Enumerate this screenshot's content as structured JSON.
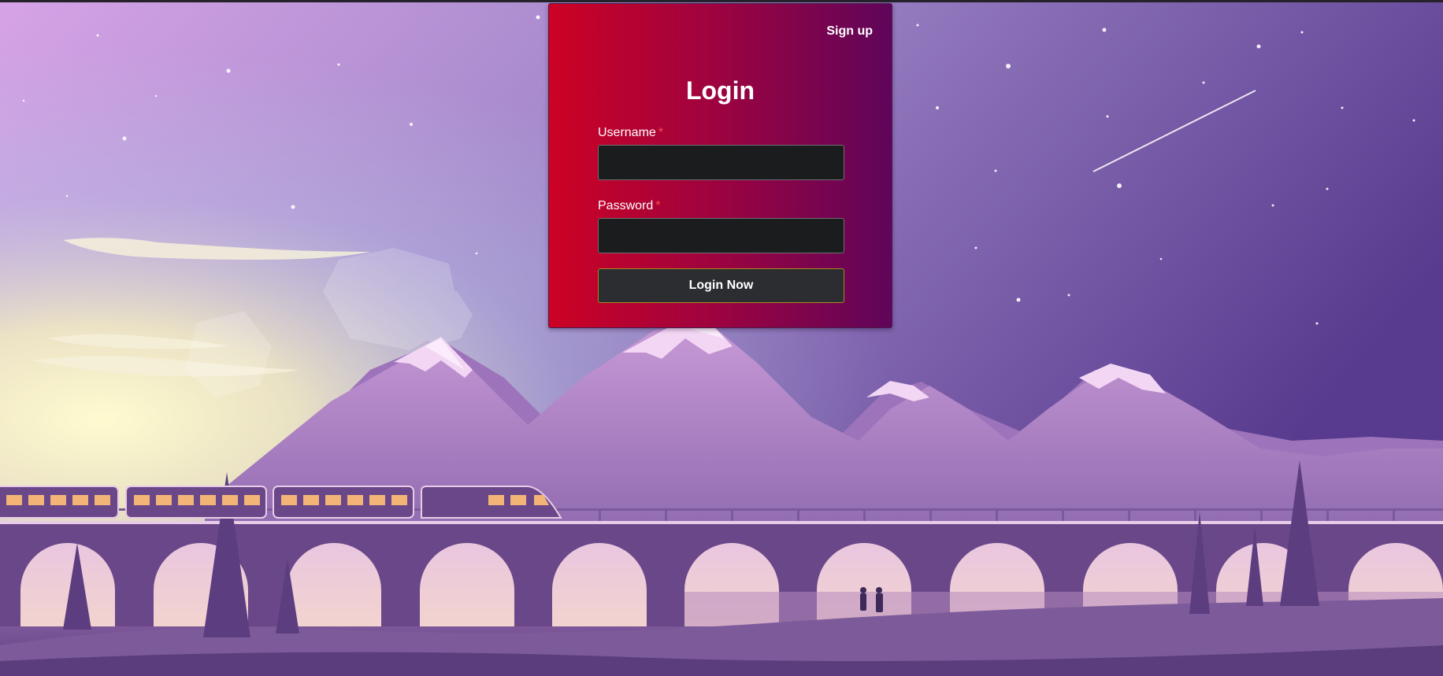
{
  "header": {
    "signup_label": "Sign up"
  },
  "login": {
    "title": "Login",
    "username_label": "Username",
    "password_label": "Password",
    "required_marker": "*",
    "username_value": "",
    "password_value": "",
    "submit_label": "Login Now"
  },
  "theme": {
    "card_gradient": [
      "#cc0225",
      "#5f055a"
    ],
    "input_background": "#1b1c1e",
    "button_background": "#2b2d30",
    "required_color": "#ff4d4d"
  },
  "background": {
    "description_icon": "landscape-illustration"
  }
}
